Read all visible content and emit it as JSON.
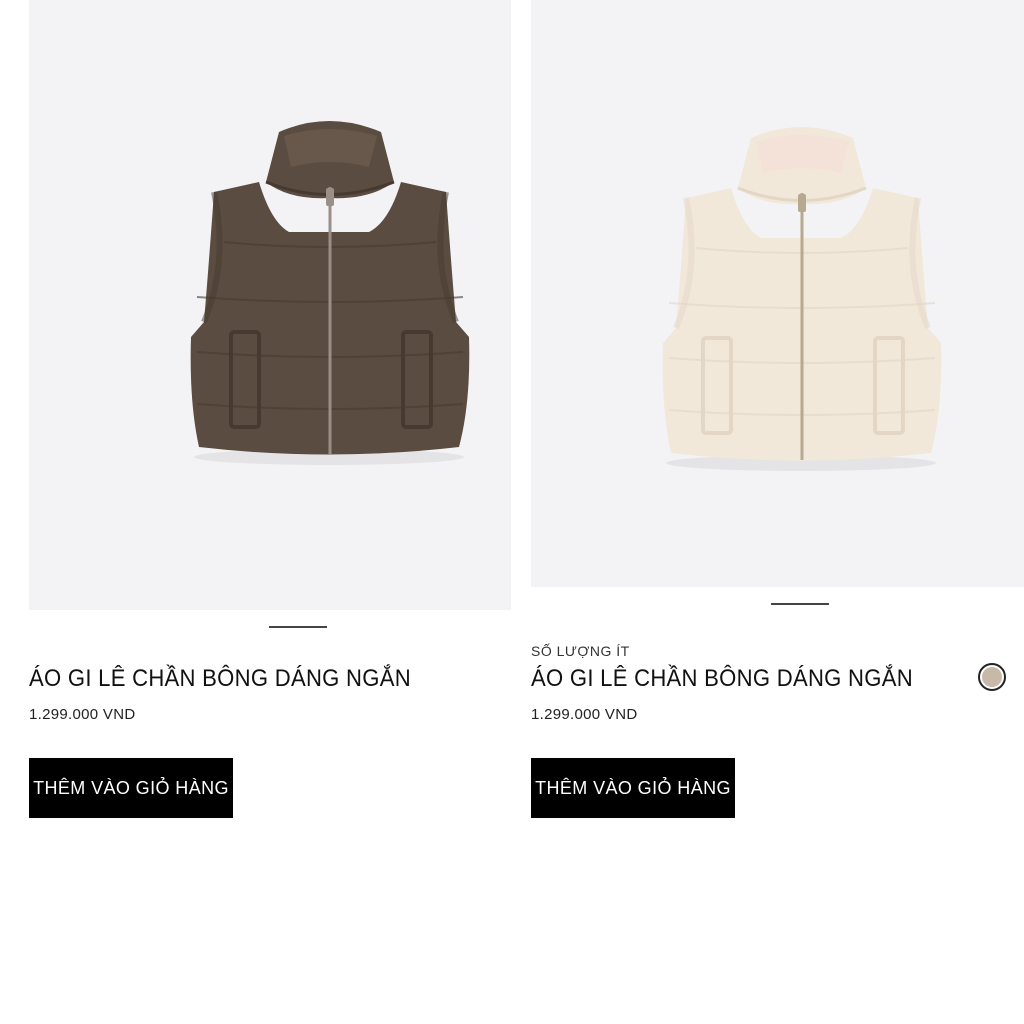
{
  "products": [
    {
      "badge": "",
      "title": "ÁO GI LÊ CHẦN BÔNG DÁNG NGẮN",
      "price": "1.299.000 VND",
      "button_label": "THÊM VÀO GIỎ HÀNG",
      "image": {
        "subject": "puffer-vest",
        "color": "#5a4c40",
        "shade": "#463a30",
        "lining": "#6b5b4d",
        "zipper": "#9a8f86"
      }
    },
    {
      "badge": "SỐ LƯỢNG ÍT",
      "title": "ÁO GI LÊ CHẦN BÔNG DÁNG NGẮN",
      "price": "1.299.000 VND",
      "button_label": "THÊM VÀO GIỎ HÀNG",
      "swatch_color": "#c7b8a8",
      "image": {
        "subject": "puffer-vest",
        "color": "#f1e8da",
        "shade": "#e3d6c5",
        "lining": "#f4dfd6",
        "zipper": "#b7a890"
      }
    }
  ]
}
